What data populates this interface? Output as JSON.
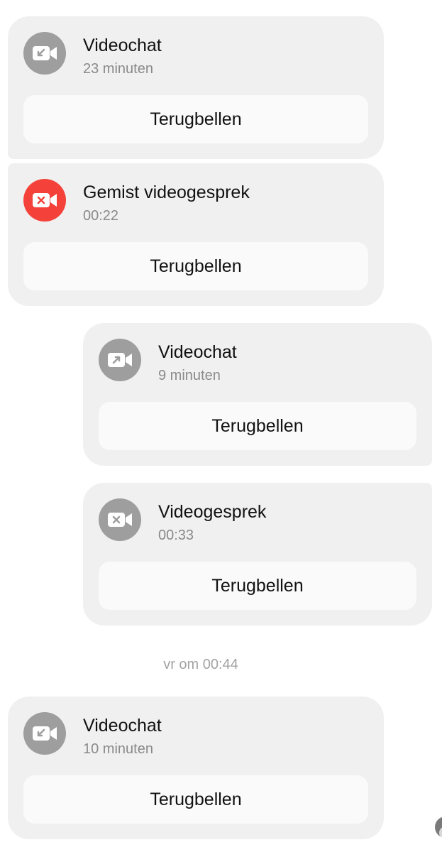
{
  "messages": [
    {
      "title": "Videochat",
      "subtitle": "23 minuten",
      "button": "Terugbellen",
      "icon": "incoming-video-call-icon",
      "status_color": "#9e9e9e"
    },
    {
      "title": "Gemist videogesprek",
      "subtitle": "00:22",
      "button": "Terugbellen",
      "icon": "missed-video-call-icon",
      "status_color": "#f4423a"
    },
    {
      "title": "Videochat",
      "subtitle": "9 minuten",
      "button": "Terugbellen",
      "icon": "outgoing-video-call-icon",
      "status_color": "#9e9e9e"
    },
    {
      "title": "Videogesprek",
      "subtitle": "00:33",
      "button": "Terugbellen",
      "icon": "cancelled-video-call-icon",
      "status_color": "#9e9e9e"
    },
    {
      "title": "Videochat",
      "subtitle": "10 minuten",
      "button": "Terugbellen",
      "icon": "incoming-video-call-icon",
      "status_color": "#9e9e9e"
    }
  ],
  "date_separator": "vr om 00:44",
  "colors": {
    "bubble_bg": "#f0f0f0",
    "button_bg": "#fafafa",
    "missed": "#f4423a",
    "icon_grey": "#9e9e9e"
  }
}
